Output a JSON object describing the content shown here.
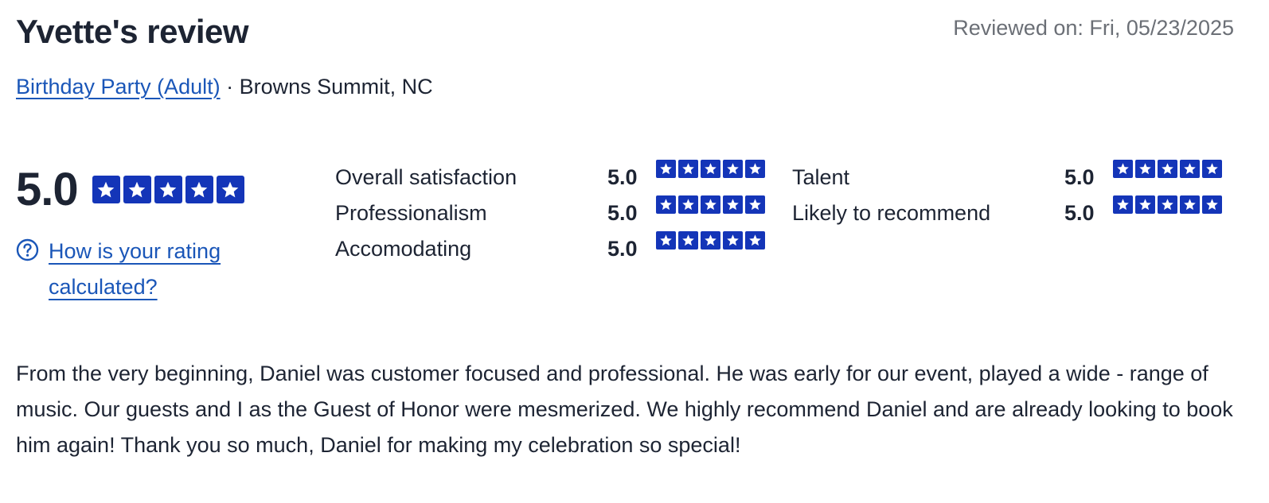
{
  "header": {
    "title": "Yvette's review",
    "reviewed_on": "Reviewed on: Fri, 05/23/2025"
  },
  "subheader": {
    "event_type": "Birthday Party (Adult)",
    "separator": " · ",
    "location": "Browns Summit, NC"
  },
  "overall": {
    "score": "5.0",
    "stars": 5,
    "how_link": "How is your rating calculated?"
  },
  "metrics": [
    {
      "label": "Overall satisfaction",
      "score": "5.0",
      "stars": 5
    },
    {
      "label": "Professionalism",
      "score": "5.0",
      "stars": 5
    },
    {
      "label": "Accomodating",
      "score": "5.0",
      "stars": 5
    },
    {
      "label": "Talent",
      "score": "5.0",
      "stars": 5
    },
    {
      "label": "Likely to recommend",
      "score": "5.0",
      "stars": 5
    }
  ],
  "review": {
    "text": "From the very beginning, Daniel was customer focused and professional. He was early for our event, played a wide - range of music. Our guests and I as the Guest of Honor were mesmerized. We highly recommend Daniel and are already looking to book him again! Thank you so much, Daniel for making my celebration so special!"
  },
  "colors": {
    "star_background": "#1435b8",
    "link": "#1a56b8",
    "text": "#1d2433",
    "muted": "#6b6f76"
  },
  "icons": {
    "star": "star-icon",
    "help": "question-circle-icon"
  }
}
